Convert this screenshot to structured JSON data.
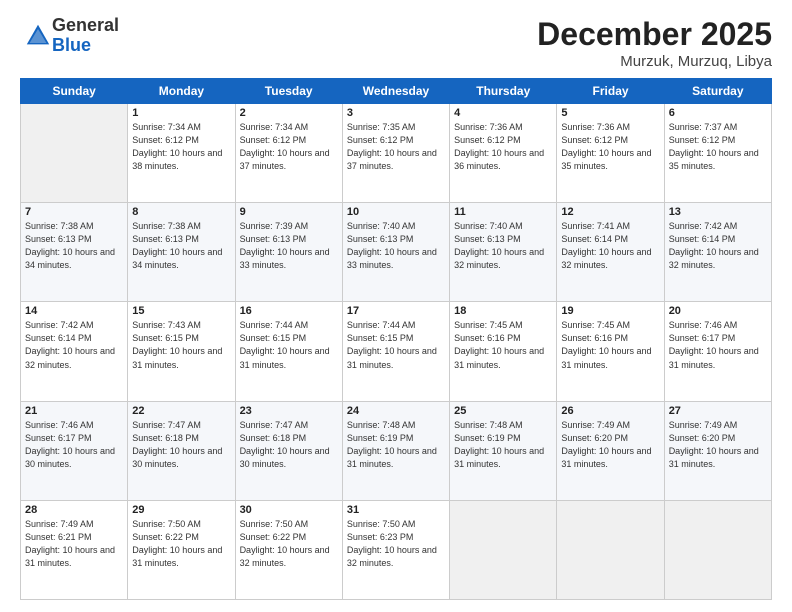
{
  "logo": {
    "general": "General",
    "blue": "Blue"
  },
  "title": "December 2025",
  "subtitle": "Murzuk, Murzuq, Libya",
  "headers": [
    "Sunday",
    "Monday",
    "Tuesday",
    "Wednesday",
    "Thursday",
    "Friday",
    "Saturday"
  ],
  "weeks": [
    [
      {
        "day": "",
        "info": ""
      },
      {
        "day": "1",
        "info": "Sunrise: 7:34 AM\nSunset: 6:12 PM\nDaylight: 10 hours and 38 minutes."
      },
      {
        "day": "2",
        "info": "Sunrise: 7:34 AM\nSunset: 6:12 PM\nDaylight: 10 hours and 37 minutes."
      },
      {
        "day": "3",
        "info": "Sunrise: 7:35 AM\nSunset: 6:12 PM\nDaylight: 10 hours and 37 minutes."
      },
      {
        "day": "4",
        "info": "Sunrise: 7:36 AM\nSunset: 6:12 PM\nDaylight: 10 hours and 36 minutes."
      },
      {
        "day": "5",
        "info": "Sunrise: 7:36 AM\nSunset: 6:12 PM\nDaylight: 10 hours and 35 minutes."
      },
      {
        "day": "6",
        "info": "Sunrise: 7:37 AM\nSunset: 6:12 PM\nDaylight: 10 hours and 35 minutes."
      }
    ],
    [
      {
        "day": "7",
        "info": "Sunrise: 7:38 AM\nSunset: 6:13 PM\nDaylight: 10 hours and 34 minutes."
      },
      {
        "day": "8",
        "info": "Sunrise: 7:38 AM\nSunset: 6:13 PM\nDaylight: 10 hours and 34 minutes."
      },
      {
        "day": "9",
        "info": "Sunrise: 7:39 AM\nSunset: 6:13 PM\nDaylight: 10 hours and 33 minutes."
      },
      {
        "day": "10",
        "info": "Sunrise: 7:40 AM\nSunset: 6:13 PM\nDaylight: 10 hours and 33 minutes."
      },
      {
        "day": "11",
        "info": "Sunrise: 7:40 AM\nSunset: 6:13 PM\nDaylight: 10 hours and 32 minutes."
      },
      {
        "day": "12",
        "info": "Sunrise: 7:41 AM\nSunset: 6:14 PM\nDaylight: 10 hours and 32 minutes."
      },
      {
        "day": "13",
        "info": "Sunrise: 7:42 AM\nSunset: 6:14 PM\nDaylight: 10 hours and 32 minutes."
      }
    ],
    [
      {
        "day": "14",
        "info": "Sunrise: 7:42 AM\nSunset: 6:14 PM\nDaylight: 10 hours and 32 minutes."
      },
      {
        "day": "15",
        "info": "Sunrise: 7:43 AM\nSunset: 6:15 PM\nDaylight: 10 hours and 31 minutes."
      },
      {
        "day": "16",
        "info": "Sunrise: 7:44 AM\nSunset: 6:15 PM\nDaylight: 10 hours and 31 minutes."
      },
      {
        "day": "17",
        "info": "Sunrise: 7:44 AM\nSunset: 6:15 PM\nDaylight: 10 hours and 31 minutes."
      },
      {
        "day": "18",
        "info": "Sunrise: 7:45 AM\nSunset: 6:16 PM\nDaylight: 10 hours and 31 minutes."
      },
      {
        "day": "19",
        "info": "Sunrise: 7:45 AM\nSunset: 6:16 PM\nDaylight: 10 hours and 31 minutes."
      },
      {
        "day": "20",
        "info": "Sunrise: 7:46 AM\nSunset: 6:17 PM\nDaylight: 10 hours and 31 minutes."
      }
    ],
    [
      {
        "day": "21",
        "info": "Sunrise: 7:46 AM\nSunset: 6:17 PM\nDaylight: 10 hours and 30 minutes."
      },
      {
        "day": "22",
        "info": "Sunrise: 7:47 AM\nSunset: 6:18 PM\nDaylight: 10 hours and 30 minutes."
      },
      {
        "day": "23",
        "info": "Sunrise: 7:47 AM\nSunset: 6:18 PM\nDaylight: 10 hours and 30 minutes."
      },
      {
        "day": "24",
        "info": "Sunrise: 7:48 AM\nSunset: 6:19 PM\nDaylight: 10 hours and 31 minutes."
      },
      {
        "day": "25",
        "info": "Sunrise: 7:48 AM\nSunset: 6:19 PM\nDaylight: 10 hours and 31 minutes."
      },
      {
        "day": "26",
        "info": "Sunrise: 7:49 AM\nSunset: 6:20 PM\nDaylight: 10 hours and 31 minutes."
      },
      {
        "day": "27",
        "info": "Sunrise: 7:49 AM\nSunset: 6:20 PM\nDaylight: 10 hours and 31 minutes."
      }
    ],
    [
      {
        "day": "28",
        "info": "Sunrise: 7:49 AM\nSunset: 6:21 PM\nDaylight: 10 hours and 31 minutes."
      },
      {
        "day": "29",
        "info": "Sunrise: 7:50 AM\nSunset: 6:22 PM\nDaylight: 10 hours and 31 minutes."
      },
      {
        "day": "30",
        "info": "Sunrise: 7:50 AM\nSunset: 6:22 PM\nDaylight: 10 hours and 32 minutes."
      },
      {
        "day": "31",
        "info": "Sunrise: 7:50 AM\nSunset: 6:23 PM\nDaylight: 10 hours and 32 minutes."
      },
      {
        "day": "",
        "info": ""
      },
      {
        "day": "",
        "info": ""
      },
      {
        "day": "",
        "info": ""
      }
    ]
  ]
}
